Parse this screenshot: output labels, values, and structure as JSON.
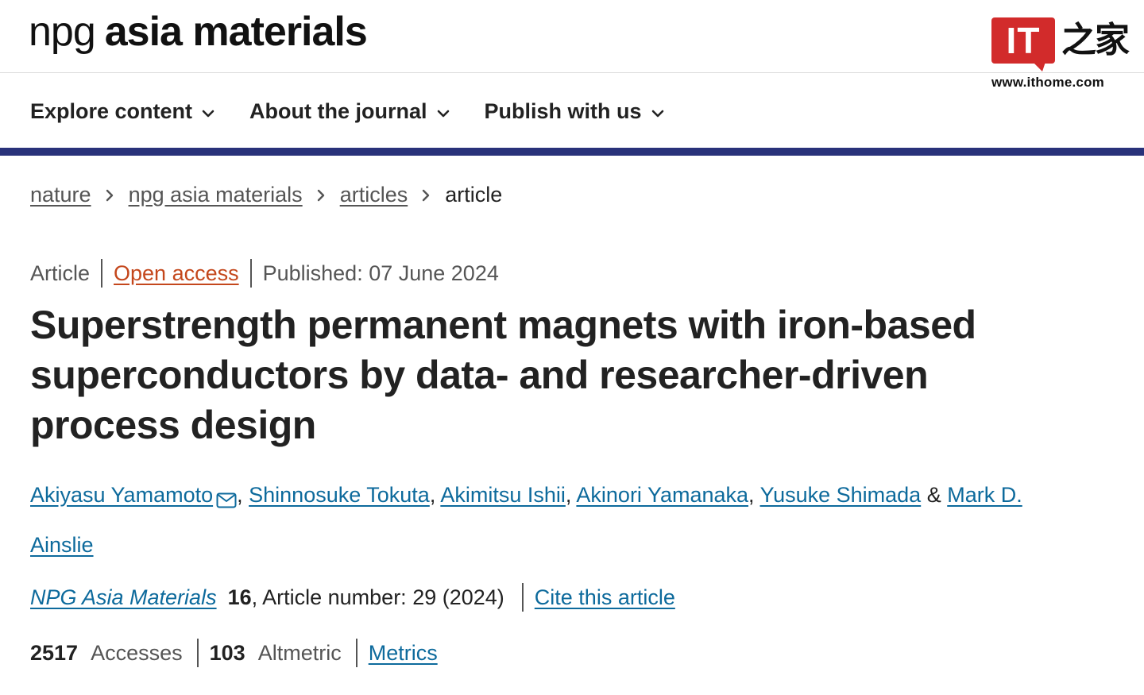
{
  "header": {
    "logo_light": "npg",
    "logo_bold": "asia materials"
  },
  "watermark": {
    "badge": "IT",
    "chars": "之家",
    "url": "www.ithome.com",
    "color": "#d22b2b"
  },
  "nav": {
    "items": [
      {
        "label": "Explore content",
        "icon": "chevron-down-icon"
      },
      {
        "label": "About the journal",
        "icon": "chevron-down-icon"
      },
      {
        "label": "Publish with us",
        "icon": "chevron-down-icon"
      }
    ],
    "accent_color": "#29327a"
  },
  "breadcrumb": {
    "items": [
      "nature",
      "npg asia materials",
      "articles"
    ],
    "current": "article",
    "separator_icon": "chevron-right-icon"
  },
  "article": {
    "type": "Article",
    "access": "Open access",
    "published": "Published: 07 June 2024",
    "title": "Superstrength permanent magnets with iron-based superconductors by data- and researcher-driven process design",
    "authors": [
      "Akiyasu Yamamoto",
      "Shinnosuke Tokuta",
      "Akimitsu Ishii",
      "Akinori Yamanaka",
      "Yusuke Shimada",
      "Mark D. Ainslie"
    ],
    "author_separator": ",",
    "author_final_separator": "&",
    "corresponding_icon": "mail-icon",
    "journal_name": "NPG Asia Materials",
    "volume": "16",
    "article_number": ", Article number: 29 (2024)",
    "cite_label": "Cite this article"
  },
  "metrics": {
    "accesses_value": "2517",
    "accesses_label": "Accesses",
    "altmetric_value": "103",
    "altmetric_label": "Altmetric",
    "metrics_link": "Metrics"
  },
  "colors": {
    "link": "#0d6a9c",
    "open_access": "#c4471c",
    "text": "#222222",
    "muted": "#555555"
  }
}
